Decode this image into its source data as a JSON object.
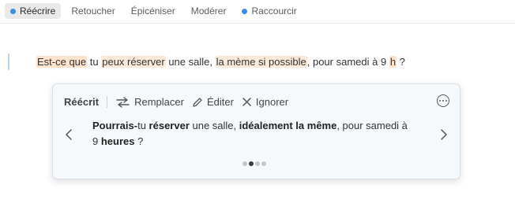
{
  "tabs": [
    {
      "label": "Réécrire",
      "active": true,
      "dot": true
    },
    {
      "label": "Retoucher",
      "active": false,
      "dot": false
    },
    {
      "label": "Épicéniser",
      "active": false,
      "dot": false
    },
    {
      "label": "Modérer",
      "active": false,
      "dot": false
    },
    {
      "label": "Raccourcir",
      "active": false,
      "dot": true
    }
  ],
  "original": {
    "seg0": "Est-ce que",
    "seg1": " tu ",
    "seg2": "peux réserver",
    "seg3": " une salle, ",
    "seg4": "la mème si possible",
    "seg5": ", pour samedi à 9 ",
    "seg6": "h",
    "seg7": " ?"
  },
  "card": {
    "title": "Réécrit",
    "replace_label": "Remplacer",
    "edit_label": "Éditer",
    "ignore_label": "Ignorer",
    "suggestion": {
      "p0": "Pourrais-",
      "p1": "tu ",
      "p2": "réserver",
      "p3": " une salle, ",
      "p4": "idéalement la même",
      "p5": ", pour samedi à ",
      "p6": "9 ",
      "p7": "heures",
      "p8": " ?"
    },
    "pager": {
      "total": 4,
      "current": 2
    }
  },
  "colors": {
    "accent": "#3b8ee0",
    "highlight": "#fde2cc"
  },
  "icons": [
    "replace-arrows-icon",
    "pencil-icon",
    "close-icon",
    "more-options-icon",
    "chevron-left-icon",
    "chevron-right-icon"
  ]
}
